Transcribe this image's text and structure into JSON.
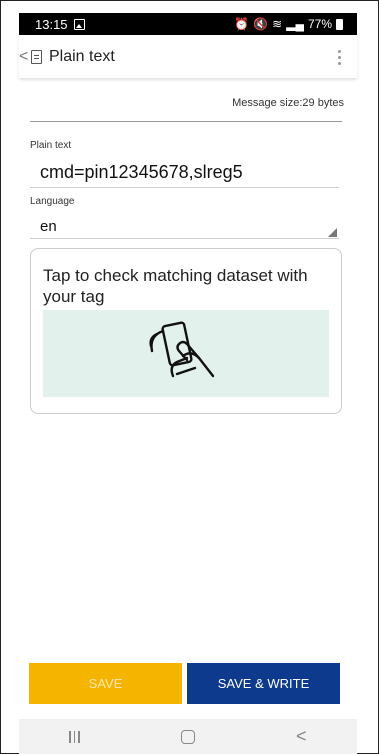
{
  "status_bar": {
    "time": "13:15",
    "icons": [
      "image-icon",
      "alarm-icon",
      "mute-icon",
      "wifi-icon",
      "signal-icon",
      "battery-icon"
    ],
    "battery_text": "77%"
  },
  "app_bar": {
    "back_glyph": "<",
    "title": "Plain text",
    "more_icon": "more-vert-icon"
  },
  "message_size": "Message size:29 bytes",
  "plain_text_field": {
    "label": "Plain text",
    "value": "cmd=pin12345678,slreg5"
  },
  "language_field": {
    "label": "Language",
    "value": "en"
  },
  "card": {
    "text": "Tap to check matching dataset with your tag",
    "illustration": "nfc-tap-icon",
    "bg_color": "#e3f1ec"
  },
  "buttons": {
    "save_label": "SAVE",
    "save_write_label": "SAVE & WRITE",
    "save_color": "#f5b400",
    "save_write_color": "#0d3a8c"
  },
  "nav_bar": {
    "back_glyph": "<"
  }
}
